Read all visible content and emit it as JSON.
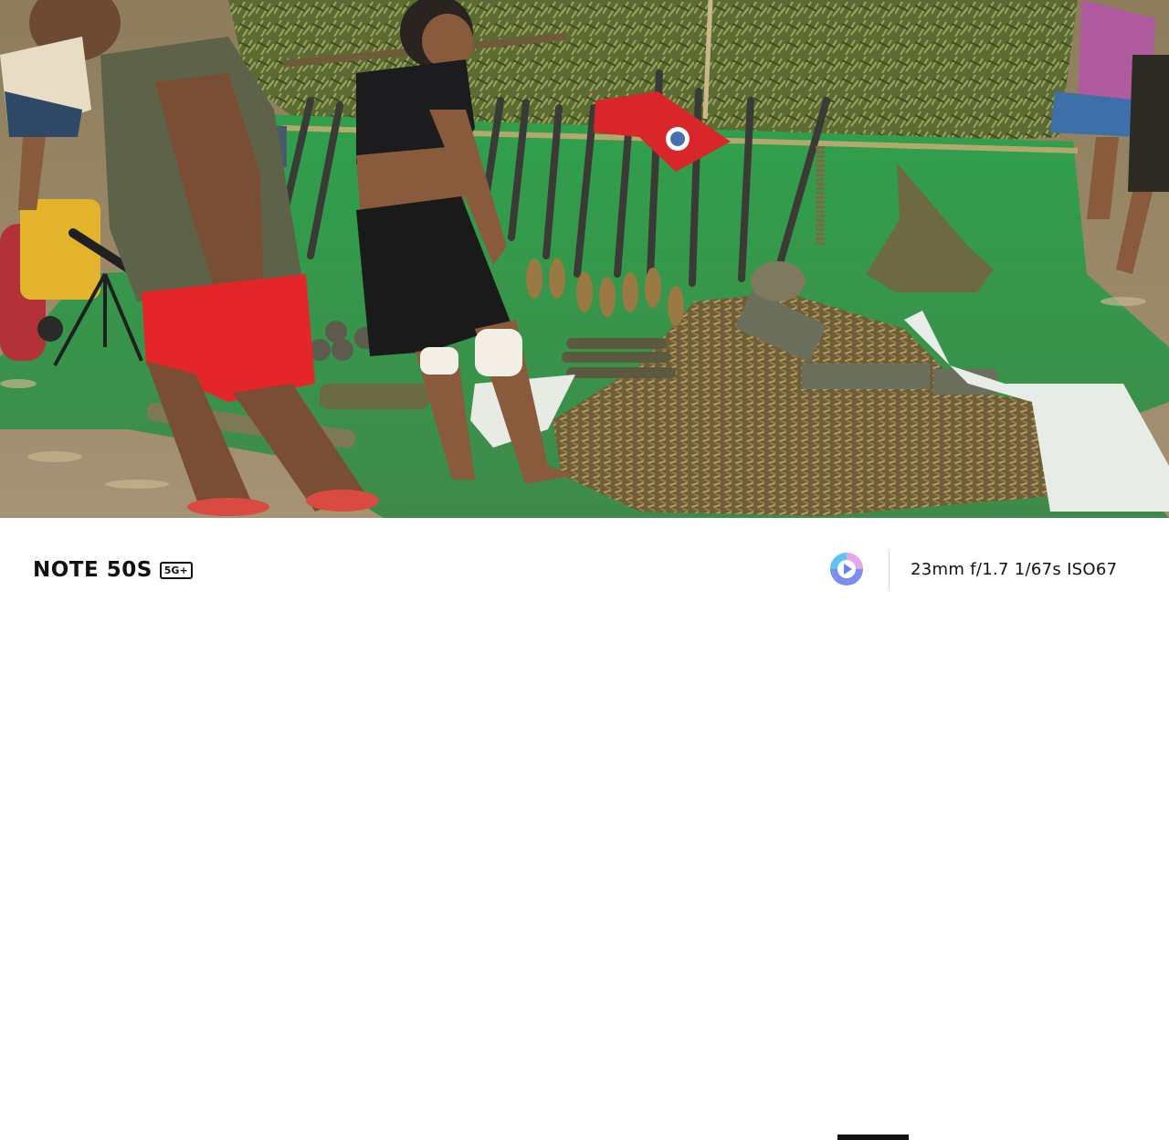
{
  "photo": {
    "description_icon": "photo-icon"
  },
  "watermark": {
    "brand": "NOTE 50S",
    "badge": "5G+",
    "camera_info": "23mm f/1.7 1/67s ISO67",
    "logo_icon": "camera-logo-icon"
  },
  "colors": {
    "tarp": "#2f9a4a",
    "flag": "#d8262b",
    "ground": "#8f7f5e",
    "brass": "#8a7446"
  }
}
